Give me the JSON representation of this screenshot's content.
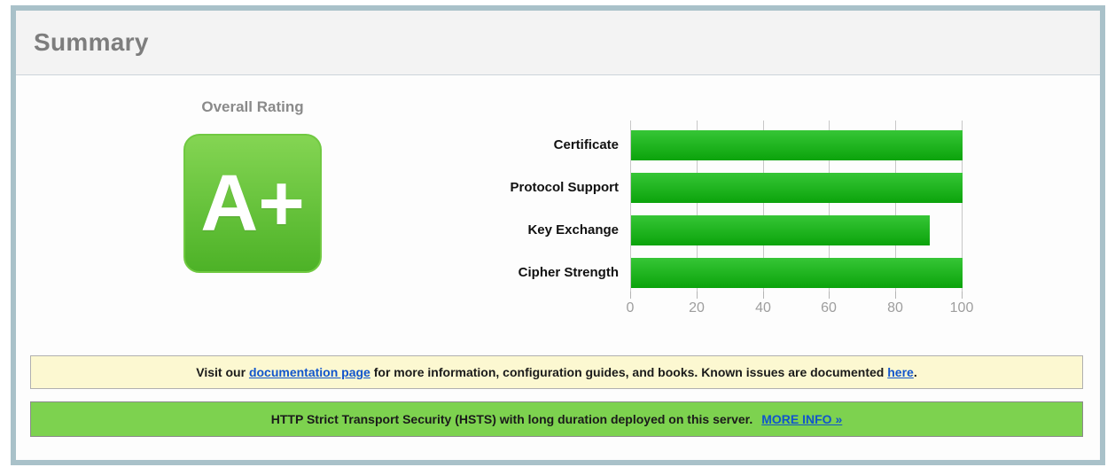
{
  "header": {
    "title": "Summary"
  },
  "overall_rating": {
    "label": "Overall Rating",
    "grade": "A+"
  },
  "chart_data": {
    "type": "bar",
    "orientation": "horizontal",
    "title": "",
    "categories": [
      "Certificate",
      "Protocol Support",
      "Key Exchange",
      "Cipher Strength"
    ],
    "values": [
      100,
      100,
      90,
      100
    ],
    "xlim": [
      0,
      100
    ],
    "ticks": [
      0,
      20,
      40,
      60,
      80,
      100
    ],
    "grid": true,
    "legend": "none"
  },
  "notices": {
    "documentation": {
      "text1": "Visit our ",
      "link1": "documentation page",
      "text2": " for more information, configuration guides, and books. Known issues are documented ",
      "link2": "here",
      "text3": "."
    },
    "hsts": {
      "text": "HTTP Strict Transport Security (HSTS) with long duration deployed on this server.",
      "link": "MORE INFO »"
    }
  },
  "colors": {
    "panel_border": "#a9c1c9",
    "header_bg": "#f3f3f3",
    "header_text": "#7d7d7d",
    "badge_green_top": "#84d553",
    "badge_green_bottom": "#4db227",
    "bar_green_top": "#36c636",
    "bar_green_bottom": "#0ba30b",
    "notice_yellow_bg": "#fcf8d1",
    "notice_green_bg": "#7dd24f",
    "link_blue": "#1155cc"
  }
}
